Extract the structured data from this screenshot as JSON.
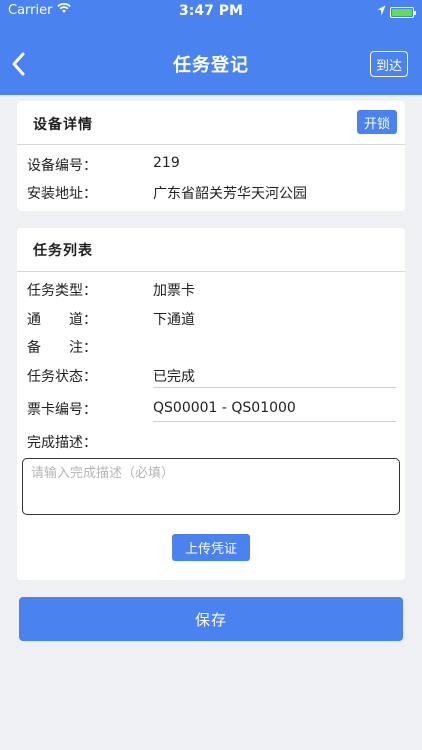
{
  "status_bar": {
    "carrier": "Carrier",
    "time": "3:47 PM"
  },
  "nav": {
    "title": "任务登记",
    "arrive_label": "到达"
  },
  "device_card": {
    "title": "设备详情",
    "unlock_label": "开锁",
    "rows": [
      {
        "label": "设备编号：",
        "value": "219"
      },
      {
        "label": "安装地址：",
        "value": "广东省韶关芳华天河公园"
      }
    ]
  },
  "task_card": {
    "title": "任务列表",
    "rows": [
      {
        "label": "任务类型：",
        "value": "加票卡"
      },
      {
        "label": "通　　道：",
        "value": "下通道"
      },
      {
        "label": "备　　注：",
        "value": ""
      },
      {
        "label": "任务状态：",
        "value": "已完成"
      },
      {
        "label": "票卡编号：",
        "value": "QS00001 - QS01000"
      },
      {
        "label": "完成描述：",
        "value": ""
      }
    ],
    "description_placeholder": "请输入完成描述（必填）",
    "upload_label": "上传凭证"
  },
  "save_label": "保存",
  "colors": {
    "accent": "#4a82f0",
    "background": "#eef0f4"
  }
}
